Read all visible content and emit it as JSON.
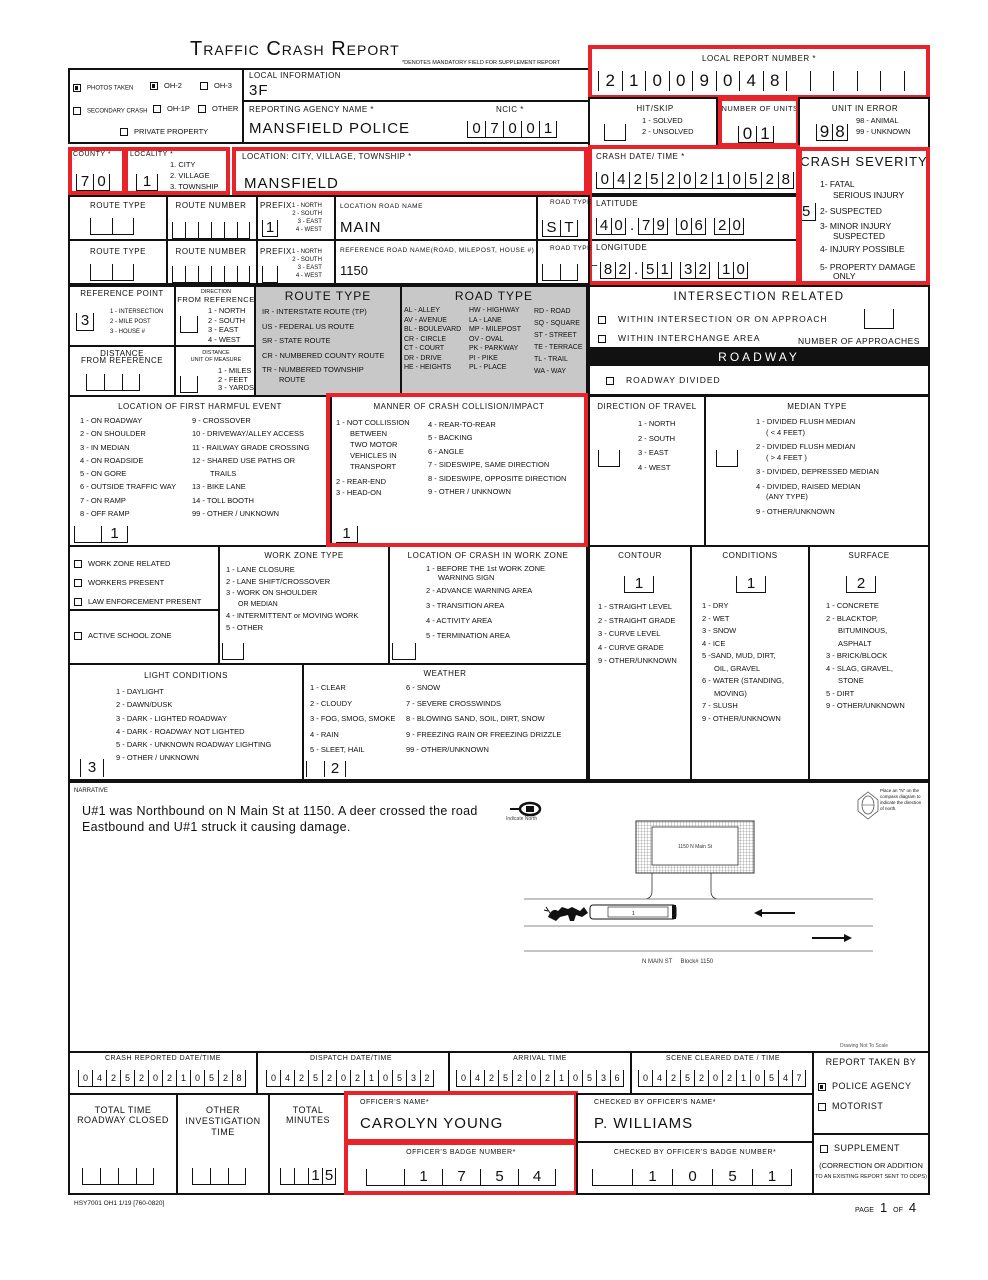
{
  "header": {
    "title": "Traffic Crash Report",
    "mandatory_note": "*DENOTES MANDATORY FIELD FOR SUPPLEMENT REPORT"
  },
  "checkboxes_top": [
    {
      "label": "PHOTOS TAKEN",
      "checked": true
    },
    {
      "label": "OH-2",
      "checked": true
    },
    {
      "label": "OH-3",
      "checked": false
    },
    {
      "label": "SECONDARY CRASH",
      "checked": false
    },
    {
      "label": "OH-1P",
      "checked": false
    },
    {
      "label": "OTHER",
      "checked": false
    },
    {
      "label": "PRIVATE PROPERTY",
      "checked": false
    }
  ],
  "local_information": {
    "label": "LOCAL INFORMATION",
    "value": "3F"
  },
  "reporting_agency": {
    "label": "REPORTING AGENCY NAME *",
    "value": "MANSFIELD POLICE"
  },
  "ncic": {
    "label": "NCIC *",
    "digits": [
      "0",
      "7",
      "0",
      "0",
      "1"
    ]
  },
  "local_report_number": {
    "label": "LOCAL REPORT NUMBER *",
    "digits": [
      "2",
      "1",
      "0",
      "0",
      "9",
      "0",
      "4",
      "8",
      "",
      "",
      "",
      "",
      "",
      ""
    ]
  },
  "hit_skip": {
    "label": "HIT/SKIP",
    "options": [
      "1 - SOLVED",
      "2 - UNSOLVED"
    ],
    "value": ""
  },
  "number_of_units": {
    "label": "NUMBER OF UNITS",
    "digits": [
      "0",
      "1"
    ]
  },
  "unit_in_error": {
    "label": "UNIT IN ERROR",
    "options": [
      "98 - ANIMAL",
      "99 - UNKNOWN"
    ],
    "digits": [
      "9",
      "8"
    ]
  },
  "county": {
    "label": "COUNTY *",
    "digits": [
      "7",
      "0"
    ]
  },
  "locality": {
    "label": "LOCALITY *",
    "options": [
      "1. CITY",
      "2. VILLAGE",
      "3. TOWNSHIP"
    ],
    "value": "1"
  },
  "location": {
    "label": "LOCATION: CITY, VILLAGE, TOWNSHIP *",
    "value": "MANSFIELD"
  },
  "crash_datetime": {
    "label": "CRASH DATE/ TIME *",
    "digits": [
      "0",
      "4",
      "2",
      "5",
      "2",
      "0",
      "2",
      "1",
      "0",
      "5",
      "2",
      "8"
    ]
  },
  "crash_severity": {
    "label": "CRASH SEVERITY",
    "value": "5",
    "options": [
      "1- FATAL",
      "SERIOUS INJURY",
      "2- SUSPECTED",
      "3- MINOR INJURY",
      "SUSPECTED",
      "4- INJURY POSSIBLE",
      "5- PROPERTY DAMAGE",
      "ONLY"
    ]
  },
  "route_row1": {
    "route_type_label": "ROUTE TYPE",
    "route_number_label": "ROUTE NUMBER",
    "prefix_label": "PREFIX",
    "prefix_options": [
      "1 - NORTH",
      "2 - SOUTH",
      "3 - EAST",
      "4 - WEST"
    ],
    "prefix_value": "1",
    "road_name_label": "LOCATION ROAD NAME",
    "road_name": "MAIN",
    "road_type_label": "ROAD TYPE",
    "road_type": [
      "S",
      "T"
    ]
  },
  "route_row2": {
    "route_type_label": "ROUTE TYPE",
    "route_number_label": "ROUTE NUMBER",
    "prefix_label": "PREFIX",
    "prefix_options": [
      "1 - NORTH",
      "2 - SOUTH",
      "3 - EAST",
      "4 - WEST"
    ],
    "prefix_value": "",
    "road_name_label": "REFERENCE ROAD NAME(ROAD, MILEPOST, HOUSE #)",
    "road_name": "1150",
    "road_type_label": "ROAD TYPE",
    "road_type": [
      "",
      ""
    ]
  },
  "latitude": {
    "label": "LATITUDE",
    "value": "40.79 06 20",
    "groups": [
      [
        "4",
        "0"
      ],
      [
        "7",
        "9"
      ],
      [
        "0",
        "6"
      ],
      [
        "2",
        "0"
      ]
    ]
  },
  "longitude": {
    "label": "LONGITUDE",
    "value": "-82.51 32 10",
    "groups": [
      [
        "8",
        "2"
      ],
      [
        "5",
        "1"
      ],
      [
        "3",
        "2"
      ],
      [
        "1",
        "0"
      ]
    ]
  },
  "reference_point": {
    "label": "REFERENCE POINT",
    "options": [
      "1 - INTERSECTION",
      "2 - MILE POST",
      "3 - HOUSE #"
    ],
    "value": "3"
  },
  "direction_from_reference": {
    "label1": "DIRECTION",
    "label2": "FROM REFERENCE",
    "options": [
      "1 - NORTH",
      "2 - SOUTH",
      "3 - EAST",
      "4 - WEST"
    ]
  },
  "distance_from_reference": {
    "label1": "DISTANCE",
    "label2": "FROM REFERENCE"
  },
  "distance_unit": {
    "label1": "DISTANCE",
    "label2": "UNIT OF MEASURE",
    "options": [
      "1 - MILES",
      "2 - FEET",
      "3 - YARDS"
    ]
  },
  "route_type_legend": {
    "label": "ROUTE TYPE",
    "items": [
      "IR - INTERSTATE ROUTE (TP)",
      "US - FEDERAL US ROUTE",
      "SR - STATE ROUTE",
      "CR - NUMBERED COUNTY ROUTE",
      "TR - NUMBERED TOWNSHIP",
      "ROUTE"
    ]
  },
  "road_type_legend": {
    "label": "ROAD TYPE",
    "col1": [
      "AL - ALLEY",
      "AV - AVENUE",
      "BL - BOULEVARD",
      "CR - CIRCLE",
      "CT - COURT",
      "DR - DRIVE",
      "HE - HEIGHTS"
    ],
    "col2": [
      "HW - HIGHWAY",
      "LA - LANE",
      "MP - MILEPOST",
      "OV - OVAL",
      "PK - PARKWAY",
      "PI - PIKE",
      "PL - PLACE"
    ],
    "col3": [
      "RD - ROAD",
      "SQ - SQUARE",
      "ST - STREET",
      "TE - TERRACE",
      "TL - TRAIL",
      "WA - WAY"
    ]
  },
  "intersection_related": {
    "label": "INTERSECTION RELATED",
    "items": [
      {
        "label": "WITHIN INTERSECTION OR ON APPROACH",
        "checked": false
      },
      {
        "label": "WITHIN INTERCHANGE AREA",
        "checked": false
      }
    ],
    "approaches_label": "NUMBER OF APPROACHES"
  },
  "roadway": {
    "label": "ROADWAY",
    "divided_label": "ROADWAY DIVIDED",
    "divided_checked": false
  },
  "first_harmful_event": {
    "label": "LOCATION OF FIRST HARMFUL EVENT",
    "col1": [
      "1 - ON ROADWAY",
      "2 - ON SHOULDER",
      "3 - IN MEDIAN",
      "4 - ON ROADSIDE",
      "5 - ON GORE",
      "6 - OUTSIDE TRAFFIC WAY",
      "7 - ON RAMP",
      "8 - OFF RAMP"
    ],
    "col2": [
      "9 - CROSSOVER",
      "10 - DRIVEWAY/ALLEY ACCESS",
      "11 - RAILWAY GRADE CROSSING",
      "12 - SHARED USE PATHS OR",
      "TRAILS",
      "13 - BIKE LANE",
      "14 - TOLL BOOTH",
      "99 - OTHER / UNKNOWN"
    ],
    "value": "1"
  },
  "manner_of_collision": {
    "label": "MANNER OF CRASH COLLISION/IMPACT",
    "col1": [
      "1 - NOT COLLISSION",
      "BETWEEN",
      "TWO MOTOR",
      "VEHICLES IN",
      "TRANSPORT",
      "2 - REAR-END",
      "3 - HEAD-ON"
    ],
    "col2": [
      "4 - REAR-TO-REAR",
      "5 - BACKING",
      "6 - ANGLE",
      "7 - SIDESWIPE, SAME DIRECTION",
      "8 - SIDESWIPE, OPPOSITE DIRECTION",
      "9 - OTHER / UNKNOWN"
    ],
    "value": "1"
  },
  "direction_of_travel": {
    "label": "DIRECTION OF TRAVEL",
    "options": [
      "1 - NORTH",
      "2 - SOUTH",
      "3 - EAST",
      "4 - WEST"
    ]
  },
  "median_type": {
    "label": "MEDIAN TYPE",
    "options": [
      "1 - DIVIDED FLUSH MEDIAN",
      "( < 4 FEET)",
      "2 - DIVIDED FLUSH MEDIAN",
      "( > 4 FEET )",
      "3 - DIVIDED, DEPRESSED MEDIAN",
      "4 - DIVIDED, RAISED MEDIAN",
      "(ANY TYPE)",
      "9 - OTHER/UNKNOWN"
    ]
  },
  "work_zone_flags": [
    {
      "label": "WORK ZONE RELATED",
      "checked": false
    },
    {
      "label": "WORKERS PRESENT",
      "checked": false
    },
    {
      "label": "LAW ENFORCEMENT PRESENT",
      "checked": false
    },
    {
      "label": "ACTIVE SCHOOL ZONE",
      "checked": false
    }
  ],
  "work_zone_type": {
    "label": "WORK ZONE TYPE",
    "options": [
      "1 - LANE CLOSURE",
      "2 - LANE SHIFT/CROSSOVER",
      "3 - WORK ON SHOULDER",
      "OR MEDIAN",
      "4 - INTERMITTENT or MOVING WORK",
      "5 - OTHER"
    ]
  },
  "work_zone_location": {
    "label": "LOCATION OF CRASH IN WORK ZONE",
    "options": [
      "1 - BEFORE THE 1st WORK ZONE",
      "WARNING SIGN",
      "2 - ADVANCE WARNING AREA",
      "3 - TRANSITION AREA",
      "4 - ACTIVITY AREA",
      "5 - TERMINATION AREA"
    ]
  },
  "contour": {
    "label": "CONTOUR",
    "value": "1",
    "options": [
      "1 - STRAIGHT LEVEL",
      "2 - STRAIGHT GRADE",
      "3 - CURVE LEVEL",
      "4 - CURVE GRADE",
      "9 - OTHER/UNKNOWN"
    ]
  },
  "conditions": {
    "label": "CONDITIONS",
    "value": "1",
    "options": [
      "1 - DRY",
      "2 - WET",
      "3 - SNOW",
      "4 - ICE",
      "5 -SAND, MUD, DIRT,",
      "OIL, GRAVEL",
      "6 - WATER (STANDING,",
      "MOVING)",
      "7 - SLUSH",
      "9 - OTHER/UNKNOWN"
    ]
  },
  "surface": {
    "label": "SURFACE",
    "value": "2",
    "options": [
      "1 - CONCRETE",
      "2 - BLACKTOP,",
      "BITUMINOUS,",
      "ASPHALT",
      "3 - BRICK/BLOCK",
      "4 - SLAG, GRAVEL,",
      "STONE",
      "5 - DIRT",
      "9 - OTHER/UNKNOWN"
    ]
  },
  "light_conditions": {
    "label": "LIGHT CONDITIONS",
    "value": "3",
    "options": [
      "1 - DAYLIGHT",
      "2 - DAWN/DUSK",
      "3 - DARK - LIGHTED ROADWAY",
      "4 - DARK - ROADWAY NOT LIGHTED",
      "5 - DARK - UNKNOWN ROADWAY LIGHTING",
      "9 - OTHER / UNKNOWN"
    ]
  },
  "weather": {
    "label": "WEATHER",
    "value": "2",
    "col1": [
      "1 - CLEAR",
      "2 - CLOUDY",
      "3 - FOG, SMOG, SMOKE",
      "4 - RAIN",
      "5 - SLEET, HAIL"
    ],
    "col2": [
      "6 - SNOW",
      "7 - SEVERE CROSSWINDS",
      "8 - BLOWING SAND, SOIL, DIRT, SNOW",
      "9 - FREEZING RAIN OR FREEZING DRIZZLE",
      "99 - OTHER/UNKNOWN"
    ]
  },
  "narrative": {
    "label": "NARRATIVE",
    "text": "U#1 was Northbound on N Main St at 1150.  A deer crossed the road Eastbound and U#1 struck it causing damage."
  },
  "diagram": {
    "building_label": "1150 N Main St",
    "street_label": "N MAIN ST     Block# 1150",
    "not_to_scale": "Drawing Not To Scale",
    "north_label": "Indicate North",
    "compass_note": "Place an \"N\" on the compass diagram to indicate the direction of north.",
    "vehicle_label": "1"
  },
  "times": [
    {
      "label": "CRASH REPORTED DATE/TIME",
      "digits": [
        "0",
        "4",
        "2",
        "5",
        "2",
        "0",
        "2",
        "1",
        "0",
        "5",
        "2",
        "8"
      ]
    },
    {
      "label": "DISPATCH DATE/TIME",
      "digits": [
        "0",
        "4",
        "2",
        "5",
        "2",
        "0",
        "2",
        "1",
        "0",
        "5",
        "3",
        "2"
      ]
    },
    {
      "label": "ARRIVAL TIME",
      "digits": [
        "0",
        "4",
        "2",
        "5",
        "2",
        "0",
        "2",
        "1",
        "0",
        "5",
        "3",
        "6"
      ]
    },
    {
      "label": "SCENE CLEARED DATE / TIME",
      "digits": [
        "0",
        "4",
        "2",
        "5",
        "2",
        "0",
        "2",
        "1",
        "0",
        "5",
        "4",
        "7"
      ]
    }
  ],
  "report_taken_by": {
    "label": "REPORT TAKEN BY",
    "options": [
      {
        "label": "POLICE AGENCY",
        "checked": true
      },
      {
        "label": "MOTORIST",
        "checked": false
      }
    ]
  },
  "total_time_closed": {
    "label1": "TOTAL TIME",
    "label2": "ROADWAY CLOSED"
  },
  "other_investigation": {
    "label1": "OTHER",
    "label2": "INVESTIGATION",
    "label3": "TIME"
  },
  "total_minutes": {
    "label1": "TOTAL",
    "label2": "MINUTES",
    "digits": [
      "",
      "",
      "1",
      "5"
    ]
  },
  "officer_name": {
    "label": "OFFICER'S NAME*",
    "value": "CAROLYN YOUNG"
  },
  "officer_badge": {
    "label": "OFFICER'S BADGE NUMBER*",
    "digits": [
      "",
      "1",
      "7",
      "5",
      "4"
    ]
  },
  "checked_by_name": {
    "label": "CHECKED BY OFFICER'S NAME*",
    "value": "P. WILLIAMS"
  },
  "checked_by_badge": {
    "label": "CHECKED BY OFFICER'S BADGE NUMBER*",
    "digits": [
      "",
      "1",
      "0",
      "5",
      "1"
    ]
  },
  "supplement": {
    "label": "SUPPLEMENT",
    "checked": false,
    "note1": "(CORRECTION OR ADDITION",
    "note2": "TO AN EXISTING REPORT SENT TO ODPS)"
  },
  "footer": {
    "form_id": "HSY7001 OH1 1/19 [760-0820]",
    "page_label": "PAGE",
    "page": "1",
    "of_label": "OF",
    "total_pages": "4"
  }
}
